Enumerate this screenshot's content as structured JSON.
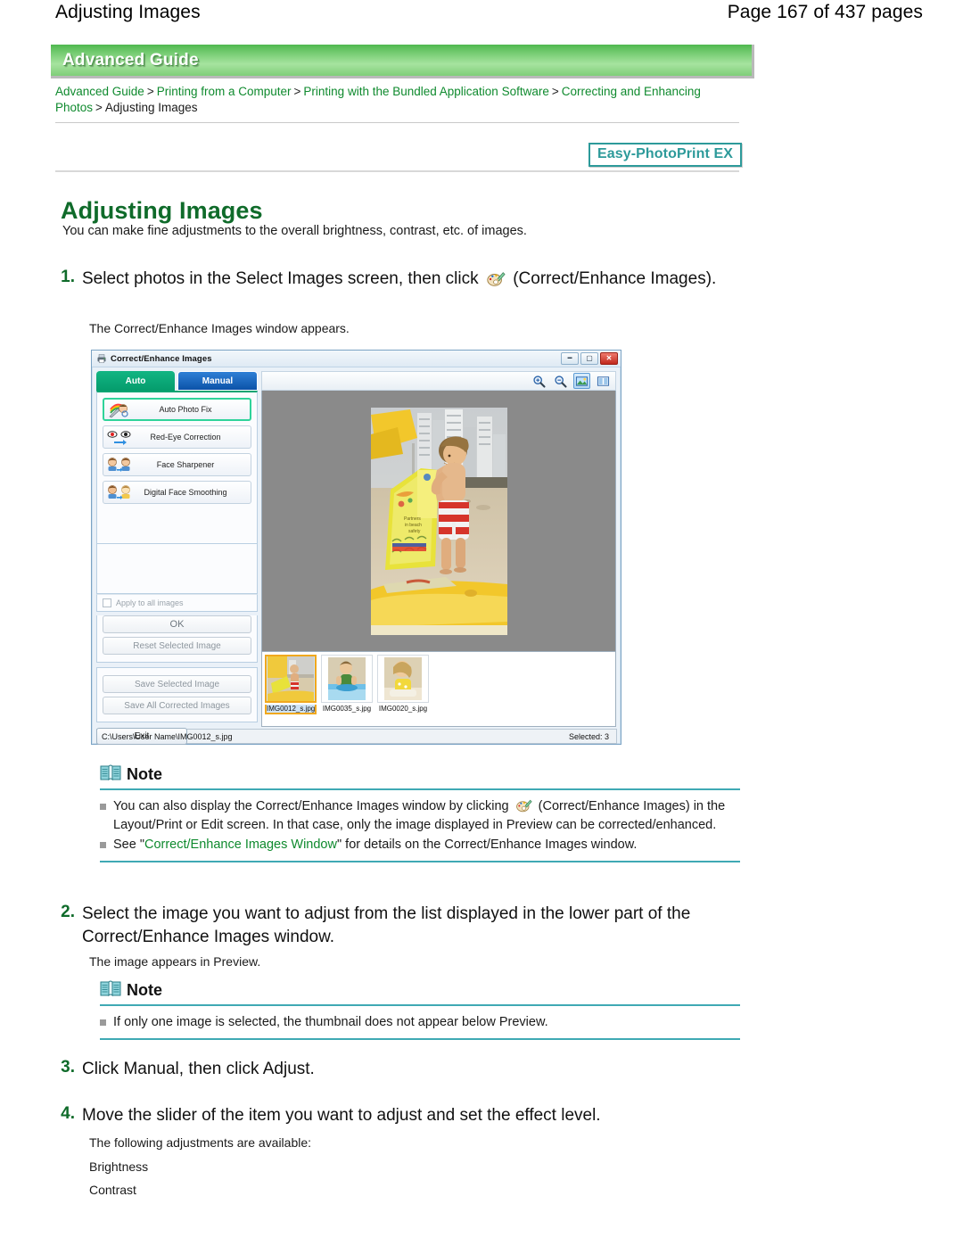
{
  "runhead": {
    "left": "Adjusting Images",
    "right": "Page 167 of 437 pages"
  },
  "banner": {
    "label": "Advanced Guide"
  },
  "breadcrumb": {
    "items": [
      {
        "label": "Advanced Guide",
        "link": true
      },
      {
        "label": "Printing from a Computer",
        "link": true
      },
      {
        "label": "Printing with the Bundled Application Software",
        "link": true
      },
      {
        "label": "Correcting and Enhancing Photos",
        "link": true
      },
      {
        "label": "Adjusting Images",
        "link": false
      }
    ],
    "separator": ">"
  },
  "badge": {
    "label": "Easy-PhotoPrint EX"
  },
  "title": "Adjusting Images",
  "intro": "You can make fine adjustments to the overall brightness, contrast, etc. of images.",
  "steps": {
    "one": {
      "num": "1.",
      "text_before": "Select photos in the Select Images screen, then click",
      "icon": "correct-enhance-palette-icon",
      "text_after": "(Correct/Enhance Images).",
      "result": "The Correct/Enhance Images window appears."
    },
    "two": {
      "num": "2.",
      "text": "Select the image you want to adjust from the list displayed in the lower part of the Correct/Enhance Images window.",
      "result": "The image appears in Preview."
    },
    "three": {
      "num": "3.",
      "text": "Click Manual, then click Adjust."
    },
    "four": {
      "num": "4.",
      "text": "Move the slider of the item you want to adjust and set the effect level.",
      "result": "The following adjustments are available:",
      "list": [
        "Brightness",
        "Contrast"
      ]
    }
  },
  "note1": {
    "icon": "note-book-icon",
    "title": "Note",
    "item1_a": "You can also display the Correct/Enhance Images window by clicking",
    "item1_icon": "correct-enhance-palette-icon",
    "item1_b": "(Correct/Enhance Images) in the Layout/Print or Edit screen. In that case, only the image displayed in Preview can be corrected/enhanced.",
    "item2_a": "See \"",
    "item2_link": "Correct/Enhance Images Window",
    "item2_b": "\" for details on the Correct/Enhance Images window."
  },
  "note2": {
    "icon": "note-book-icon",
    "title": "Note",
    "item1": "If only one image is selected, the thumbnail does not appear below Preview."
  },
  "app_window": {
    "title": "Correct/Enhance Images",
    "title_icon": "app-printer-icon",
    "window_buttons": {
      "minimize": "minimize-icon",
      "maximize": "maximize-icon",
      "close": "close-icon"
    },
    "tabs": [
      {
        "label": "Auto",
        "active": true
      },
      {
        "label": "Manual",
        "active": false
      }
    ],
    "fix_buttons": [
      {
        "label": "Auto Photo Fix",
        "icon": "auto-photo-fix-icon",
        "selected": true
      },
      {
        "label": "Red-Eye Correction",
        "icon": "red-eye-icon",
        "selected": false
      },
      {
        "label": "Face Sharpener",
        "icon": "face-sharpener-icon",
        "selected": false
      },
      {
        "label": "Digital Face Smoothing",
        "icon": "face-smoothing-icon",
        "selected": false
      }
    ],
    "apply_all": {
      "label": "Apply to all images",
      "checked": false
    },
    "ok_button": "OK",
    "reset_button": "Reset Selected Image",
    "save_selected_button": "Save Selected Image",
    "save_all_button": "Save All Corrected Images",
    "exit_button": "Exit",
    "toolbar_icons": [
      {
        "name": "zoom-in-icon",
        "active": false
      },
      {
        "name": "zoom-out-icon",
        "active": false
      },
      {
        "name": "whole-image-view-icon",
        "active": true
      },
      {
        "name": "compare-view-icon",
        "active": false
      }
    ],
    "thumbnails": [
      {
        "caption": "IMG0012_s.jpg",
        "selected": true
      },
      {
        "caption": "IMG0035_s.jpg",
        "selected": false
      },
      {
        "caption": "IMG0020_s.jpg",
        "selected": false
      }
    ],
    "status": {
      "path": "C:\\Users\\User Name\\IMG0012_s.jpg",
      "selected_count": "Selected: 3"
    }
  },
  "colors": {
    "brand_green": "#0f6b2a",
    "link_green": "#0f8a2e",
    "teal": "#2d9a9a",
    "note_rule": "#3fa9b4",
    "banner_green": "#6fc96c",
    "tab_auto": "#0aa472",
    "tab_manual": "#0b53a8",
    "thumb_select": "#f0a81e"
  }
}
